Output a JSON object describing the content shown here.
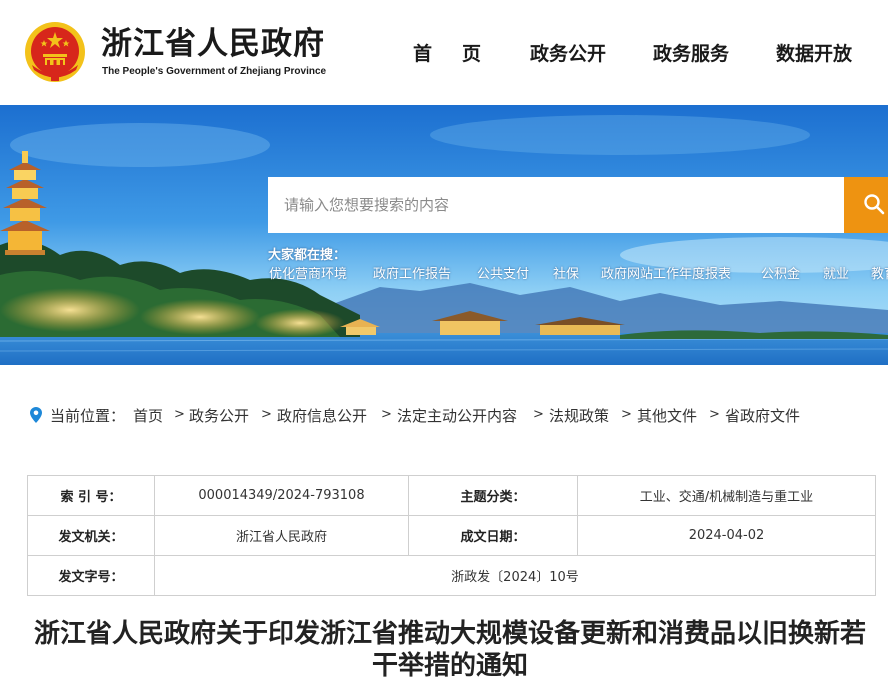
{
  "header": {
    "site_title": "浙江省人民政府",
    "site_subtitle": "The People's Government of Zhejiang Province",
    "nav": [
      {
        "label": "首页"
      },
      {
        "label": "政务公开"
      },
      {
        "label": "政务服务"
      },
      {
        "label": "数据开放"
      }
    ]
  },
  "banner": {
    "search_placeholder": "请输入您想要搜索的内容",
    "hot_label": "大家都在搜：",
    "hot_links": [
      "优化营商环境",
      "政府工作报告",
      "公共支付",
      "社保",
      "政府网站工作年度报表",
      "公积金",
      "就业",
      "教育"
    ]
  },
  "breadcrumb": {
    "label": "当前位置：",
    "items": [
      "首页",
      "政务公开",
      "政府信息公开",
      "法定主动公开内容",
      "法规政策",
      "其他文件",
      "省政府文件"
    ]
  },
  "doc_info": {
    "index_label": "索 引 号：",
    "index_value": "000014349/2024-793108",
    "category_label": "主题分类：",
    "category_value": "工业、交通/机械制造与重工业",
    "issuer_label": "发文机关：",
    "issuer_value": "浙江省人民政府",
    "date_label": "成文日期：",
    "date_value": "2024-04-02",
    "docno_label": "发文字号：",
    "docno_value": "浙政发〔2024〕10号"
  },
  "document": {
    "title": "浙江省人民政府关于印发浙江省推动大规模设备更新和消费品以旧换新若干举措的通知"
  },
  "colors": {
    "accent_orange": "#ee9311",
    "emblem_red": "#d7261b",
    "emblem_gold": "#f3c21a",
    "pin_blue": "#1e88d8",
    "banner_sky": "#2f8fe0"
  },
  "icons": {
    "emblem": "national-emblem-icon",
    "search": "search-icon",
    "location": "location-pin-icon"
  }
}
